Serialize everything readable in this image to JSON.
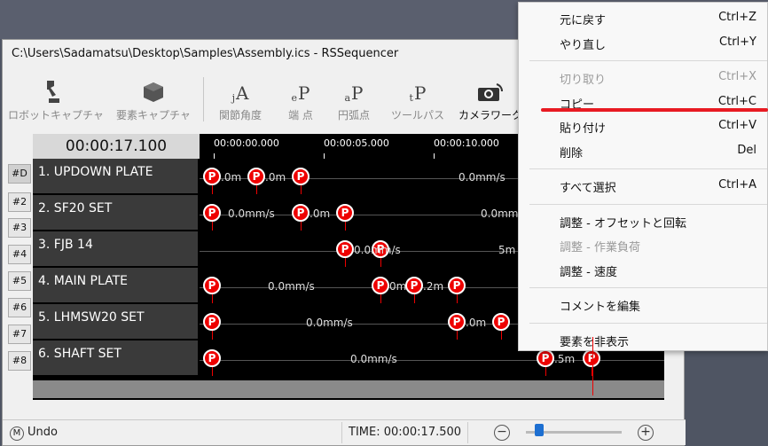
{
  "window": {
    "title": "C:\\Users\\Sadamatsu\\Desktop\\Samples\\Assembly.ics - RSSequencer"
  },
  "toolbar": [
    {
      "label": "ロボットキャプチャ",
      "icon": "robot-capture-icon",
      "glyph": ""
    },
    {
      "label": "要素キャプチャ",
      "icon": "element-capture-icon",
      "glyph": ""
    },
    {
      "label": "関節角度",
      "icon": "joint-angle-icon",
      "glyph": "A",
      "sub": "j"
    },
    {
      "label": "端 点",
      "icon": "endpoint-icon",
      "glyph": "P",
      "sub": "e"
    },
    {
      "label": "円弧点",
      "icon": "arc-point-icon",
      "glyph": "P",
      "sub": "a"
    },
    {
      "label": "ツールパス",
      "icon": "toolpath-icon",
      "glyph": "P",
      "sub": "t"
    },
    {
      "label": "カメラワーク",
      "icon": "camera-work-icon",
      "glyph": ""
    }
  ],
  "timeline": {
    "current_time": "00:00:17.100",
    "ruler": [
      "00:00:00.000",
      "00:00:05.000",
      "00:00:10.000"
    ]
  },
  "row_tabs": [
    "#D",
    "#2",
    "#3",
    "#4",
    "#5",
    "#6",
    "#7",
    "#8"
  ],
  "rows": [
    {
      "name": "1.  UPDOWN PLATE",
      "points": [
        0,
        50,
        100
      ],
      "speeds": [
        ".0m",
        ".0m",
        "0.0mm/s"
      ]
    },
    {
      "name": "2.  SF20 SET",
      "points": [
        0,
        100,
        150
      ],
      "speeds": [
        "0.0mm/s",
        ".0m",
        "0.0mm/s"
      ]
    },
    {
      "name": "3.  FJB 14",
      "points": [
        150,
        190
      ],
      "speeds": [
        "0.0mm/s",
        "5m",
        "0.0mm/s"
      ]
    },
    {
      "name": "4.  MAIN PLATE",
      "points": [
        0,
        190,
        228,
        276
      ],
      "speeds": [
        "0.0mm/s",
        "0m",
        ".2m",
        "0."
      ]
    },
    {
      "name": "5.  LHMSW20 SET",
      "points": [
        0,
        276,
        326
      ],
      "speeds": [
        "0.0mm/s",
        ".0m",
        ""
      ]
    },
    {
      "name": "6.  SHAFT SET",
      "points": [
        0,
        376,
        428
      ],
      "speeds": [
        "0.0mm/s",
        ".5m",
        ""
      ]
    }
  ],
  "status": {
    "undo_label": "Undo",
    "time_label": "TIME: 00:00:17.500",
    "zoom_minus": "−",
    "zoom_plus": "+"
  },
  "context_menu": {
    "items": [
      {
        "label": "元に戻す",
        "shortcut": "Ctrl+Z",
        "disabled": false
      },
      {
        "label": "やり直し",
        "shortcut": "Ctrl+Y",
        "disabled": false
      },
      {
        "separator": true
      },
      {
        "label": "切り取り",
        "shortcut": "Ctrl+X",
        "disabled": true
      },
      {
        "label": "コピー",
        "shortcut": "Ctrl+C",
        "disabled": false,
        "highlight": true
      },
      {
        "label": "貼り付け",
        "shortcut": "Ctrl+V",
        "disabled": false
      },
      {
        "label": "削除",
        "shortcut": "Del",
        "disabled": false
      },
      {
        "separator": true
      },
      {
        "label": "すべて選択",
        "shortcut": "Ctrl+A",
        "disabled": false
      },
      {
        "separator": true
      },
      {
        "label": "調整 - オフセットと回転",
        "shortcut": "",
        "disabled": false
      },
      {
        "label": "調整 - 作業負荷",
        "shortcut": "",
        "disabled": true
      },
      {
        "label": "調整 - 速度",
        "shortcut": "",
        "disabled": false
      },
      {
        "separator": true
      },
      {
        "label": "コメントを編集",
        "shortcut": "",
        "disabled": false
      },
      {
        "separator": true
      },
      {
        "label": "要素を非表示",
        "shortcut": "",
        "disabled": false
      }
    ]
  },
  "colors": {
    "point": "#e00000",
    "highlight_underline": "#e81a22",
    "thumb": "#1d6fd1"
  }
}
